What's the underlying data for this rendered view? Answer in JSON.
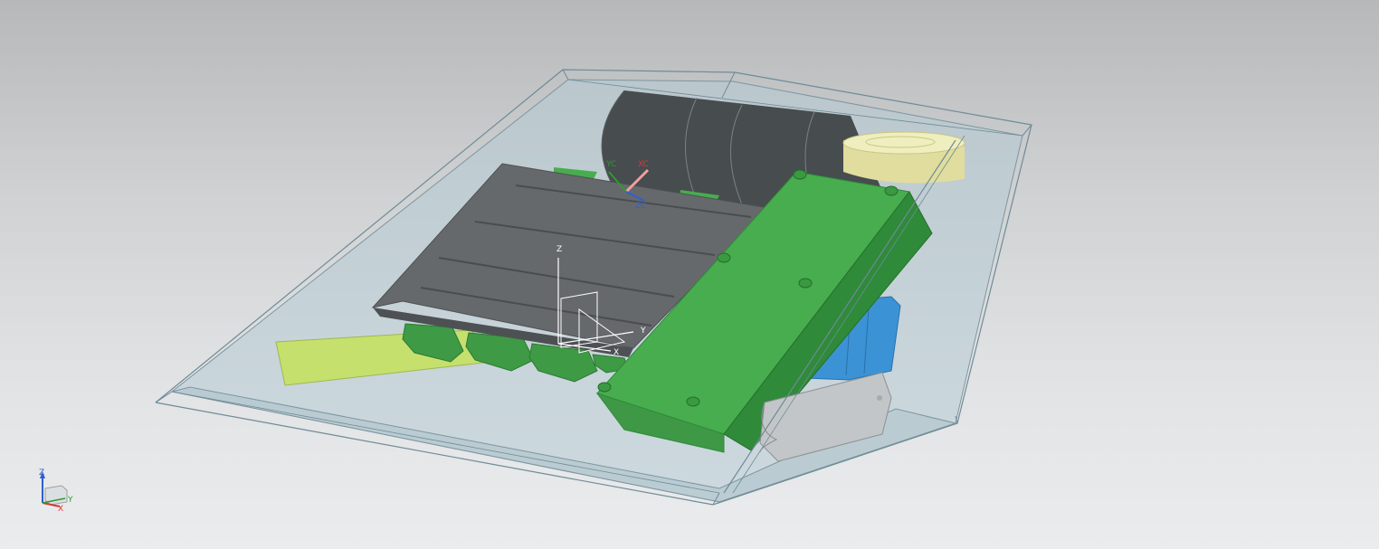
{
  "viewport": {
    "background_top": "#b6b8ba",
    "background_bottom": "#ebeced"
  },
  "colors": {
    "housing_fill": "#a9c3cc",
    "housing_edge": "#6f8b96",
    "pcb_green": "#47ad4e",
    "pcb_green_dark": "#2f8a3a",
    "plate_gray": "#66696b",
    "plate_gray_dark": "#4e5153",
    "cylinder_dark": "#474c4e",
    "yellow_part": "#e8e6a8",
    "lime_plate": "#c6e06e",
    "blue_part": "#3b93d6",
    "bracket_gray": "#c3c6c8",
    "wcs_x": "#d43a3a",
    "wcs_y": "#2e9a2e",
    "wcs_z": "#2f5fd0"
  },
  "work_csys": {
    "x_label": "XC",
    "y_label": "YC",
    "z_label": "ZC"
  },
  "datum_csys": {
    "x_label": "X",
    "y_label": "Y",
    "z_label": "Z"
  },
  "view_triad": {
    "x_label": "X",
    "y_label": "Y",
    "z_label": "Z"
  }
}
